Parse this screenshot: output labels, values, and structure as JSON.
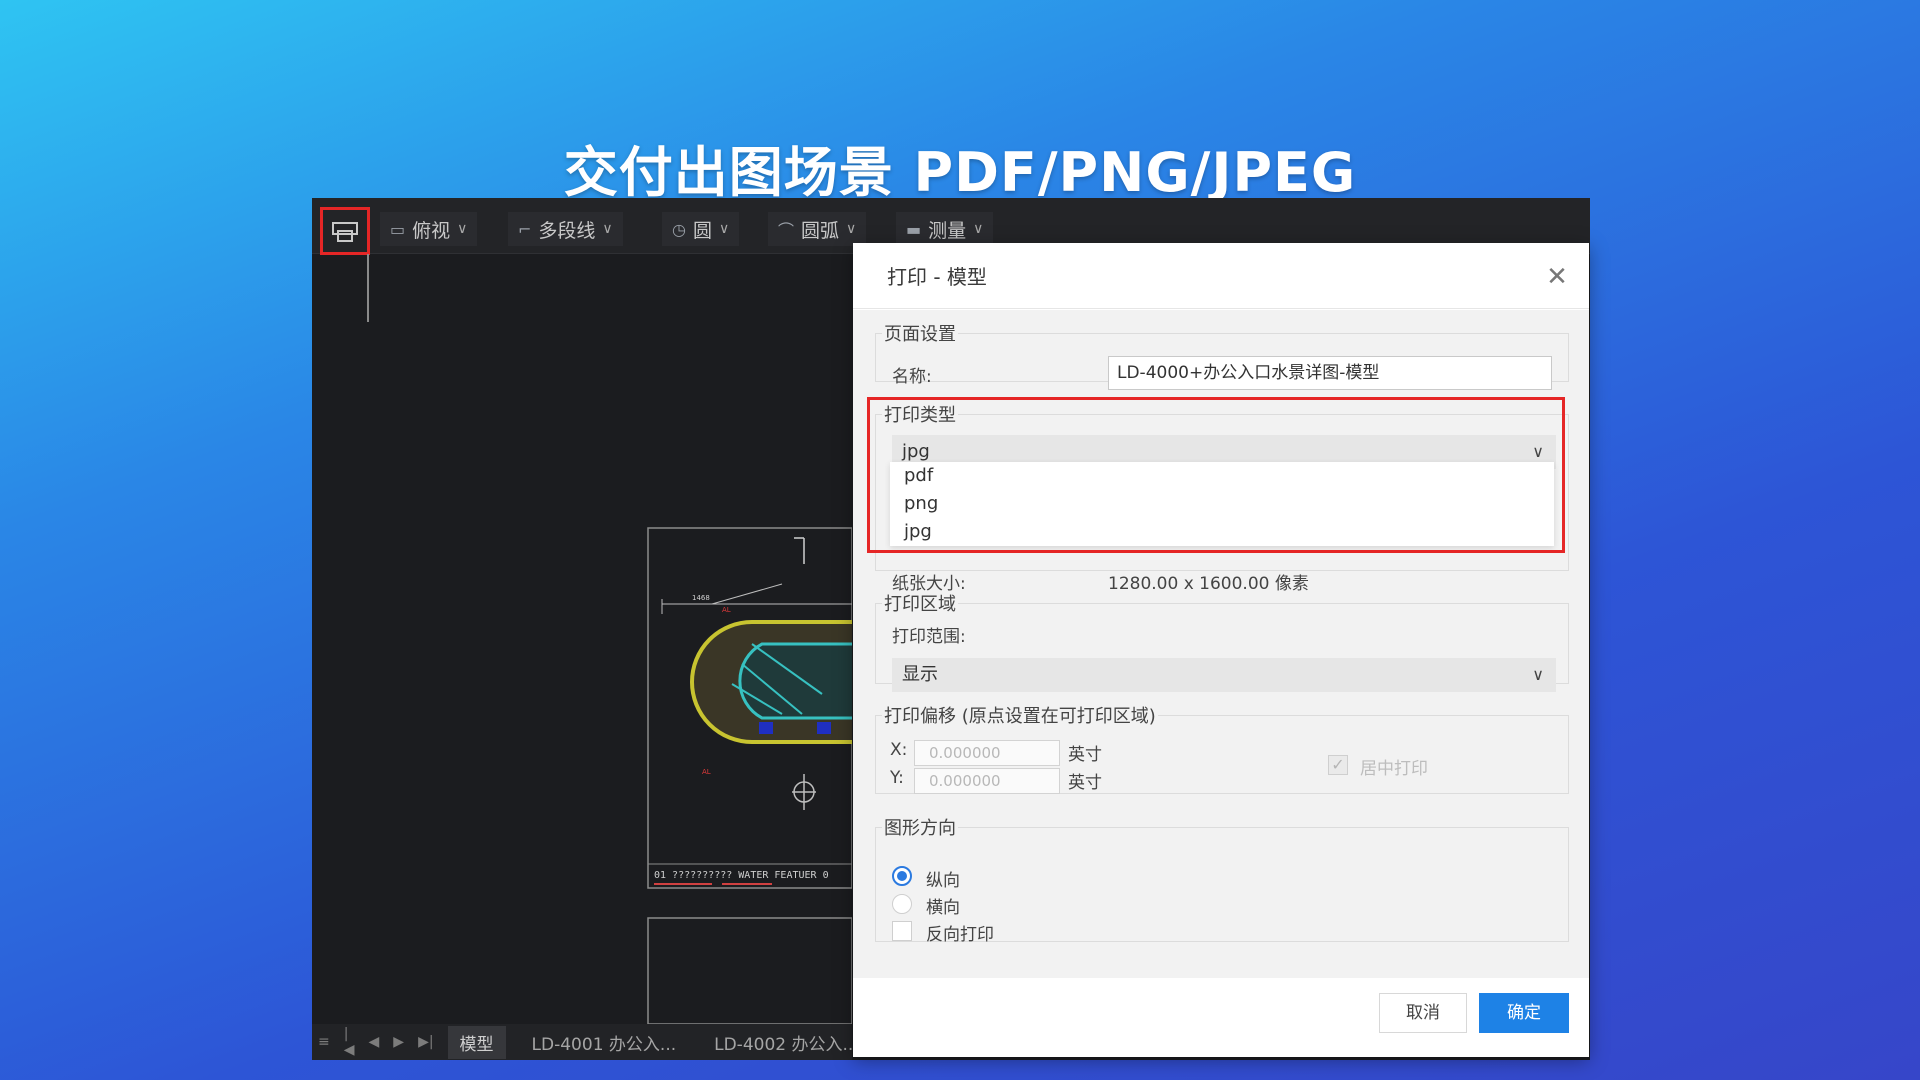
{
  "slide": {
    "title": "交付出图场景 PDF/PNG/JPEG"
  },
  "toolbar": {
    "groups": [
      {
        "label": "俯视",
        "icon": "view-icon"
      },
      {
        "label": "多段线",
        "icon": "polyline-icon"
      },
      {
        "label": "圆",
        "icon": "circle-icon"
      },
      {
        "label": "圆弧",
        "icon": "arc-icon"
      },
      {
        "label": "测量",
        "icon": "measure-icon"
      }
    ]
  },
  "drawing": {
    "title_block": "01 ?????????? WATER FEATUER 0"
  },
  "statusbar": {
    "tabs": [
      "模型",
      "LD-4001 办公入...",
      "LD-4002 办公入..."
    ]
  },
  "dialog": {
    "title": "打印 - 模型",
    "page_setup": {
      "legend": "页面设置",
      "name_label": "名称:",
      "name_value": "LD-4000+办公入口水景详图-模型"
    },
    "print_type": {
      "legend": "打印类型",
      "selected": "jpg",
      "options": [
        "pdf",
        "png",
        "jpg"
      ],
      "paper_label": "纸张大小:",
      "paper_value": "1280.00 x 1600.00 像素"
    },
    "print_area": {
      "legend": "打印区域",
      "range_label": "打印范围:",
      "range_value": "显示"
    },
    "offset": {
      "legend": "打印偏移 (原点设置在可打印区域)",
      "x_label": "X:",
      "x_value": "0.000000",
      "y_label": "Y:",
      "y_value": "0.000000",
      "unit": "英寸",
      "center_label": "居中打印"
    },
    "orientation": {
      "legend": "图形方向",
      "portrait": "纵向",
      "landscape": "横向",
      "reverse": "反向打印"
    },
    "buttons": {
      "cancel": "取消",
      "ok": "确定"
    }
  },
  "colors": {
    "highlight": "#e52626",
    "primary": "#1e82e6"
  }
}
